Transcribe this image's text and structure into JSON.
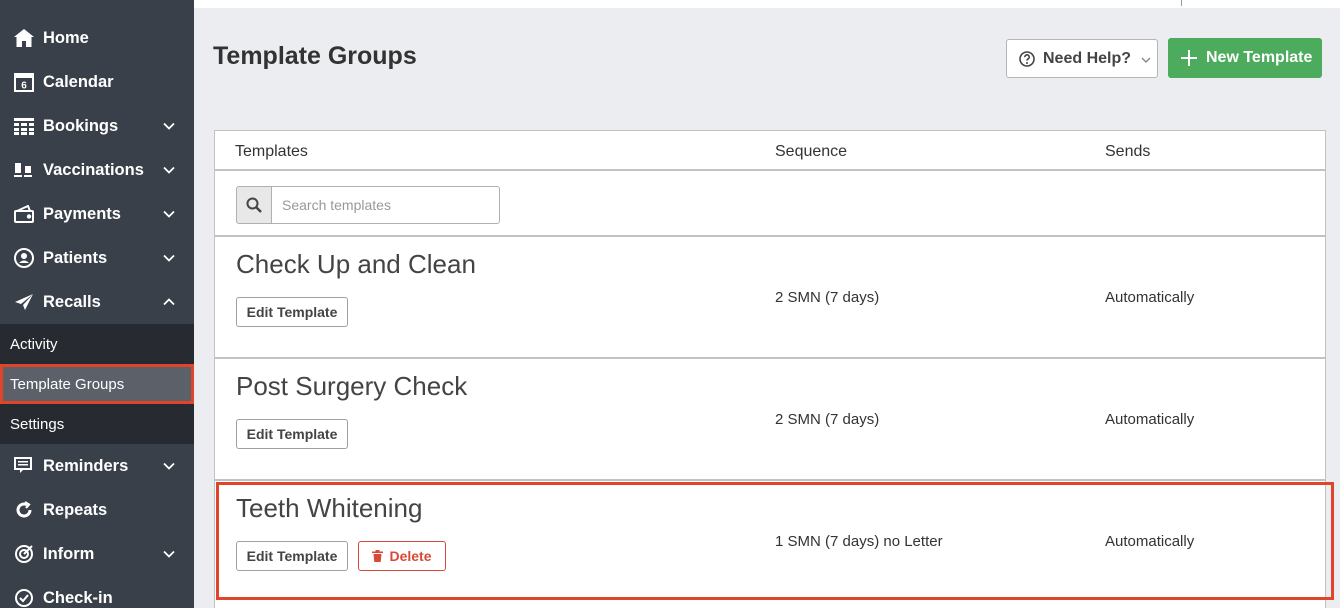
{
  "sidebar": {
    "items": [
      {
        "label": "Home",
        "icon": "home-icon"
      },
      {
        "label": "Calendar",
        "icon": "calendar-icon",
        "icon_text": "6"
      },
      {
        "label": "Bookings",
        "icon": "grid-icon"
      },
      {
        "label": "Vaccinations",
        "icon": "vials-icon"
      },
      {
        "label": "Payments",
        "icon": "wallet-icon"
      },
      {
        "label": "Patients",
        "icon": "user-circle-icon"
      },
      {
        "label": "Recalls",
        "icon": "paper-plane-icon"
      },
      {
        "label": "Reminders",
        "icon": "chat-icon"
      },
      {
        "label": "Repeats",
        "icon": "refresh-icon"
      },
      {
        "label": "Inform",
        "icon": "target-icon"
      },
      {
        "label": "Check-in",
        "icon": "check-circle-icon"
      }
    ],
    "recalls_submenu": [
      {
        "label": "Activity"
      },
      {
        "label": "Template Groups",
        "active": true
      },
      {
        "label": "Settings"
      }
    ]
  },
  "header": {
    "title": "Template Groups",
    "help_label": "Need Help?",
    "new_label": "New Template"
  },
  "table": {
    "columns": [
      "Templates",
      "Sequence",
      "Sends"
    ],
    "search": {
      "placeholder": "Search templates",
      "value": ""
    },
    "edit_label": "Edit Template",
    "delete_label": "Delete",
    "rows": [
      {
        "name": "Check Up and Clean",
        "sequence": "2 SMN (7 days)",
        "sends": "Automatically"
      },
      {
        "name": "Post Surgery Check",
        "sequence": "2 SMN (7 days)",
        "sends": "Automatically"
      },
      {
        "name": "Teeth Whitening",
        "sequence": "1 SMN (7 days) no Letter",
        "sends": "Automatically"
      }
    ]
  },
  "colors": {
    "sidebar_bg": "#3a4049",
    "submenu_bg": "#272b31",
    "highlight": "#e0452b",
    "primary_green": "#4cab5c",
    "danger": "#d9493a"
  }
}
